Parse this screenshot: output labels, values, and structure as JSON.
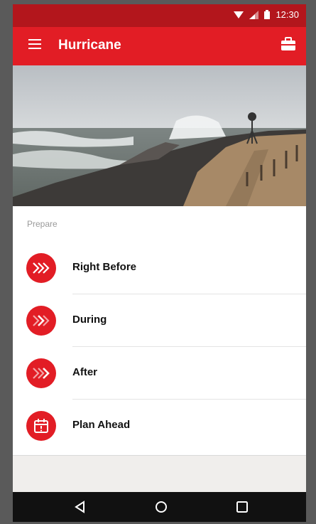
{
  "status_bar": {
    "time": "12:30"
  },
  "app_bar": {
    "title": "Hurricane"
  },
  "section": {
    "label": "Prepare"
  },
  "items": [
    {
      "label": "Right Before",
      "icon": "chevron-arrows-icon"
    },
    {
      "label": "During",
      "icon": "chevron-arrows-icon"
    },
    {
      "label": "After",
      "icon": "chevron-arrows-icon"
    },
    {
      "label": "Plan Ahead",
      "icon": "calendar-icon"
    }
  ],
  "colors": {
    "primary": "#e21d25",
    "status_bar": "#b3161c"
  }
}
